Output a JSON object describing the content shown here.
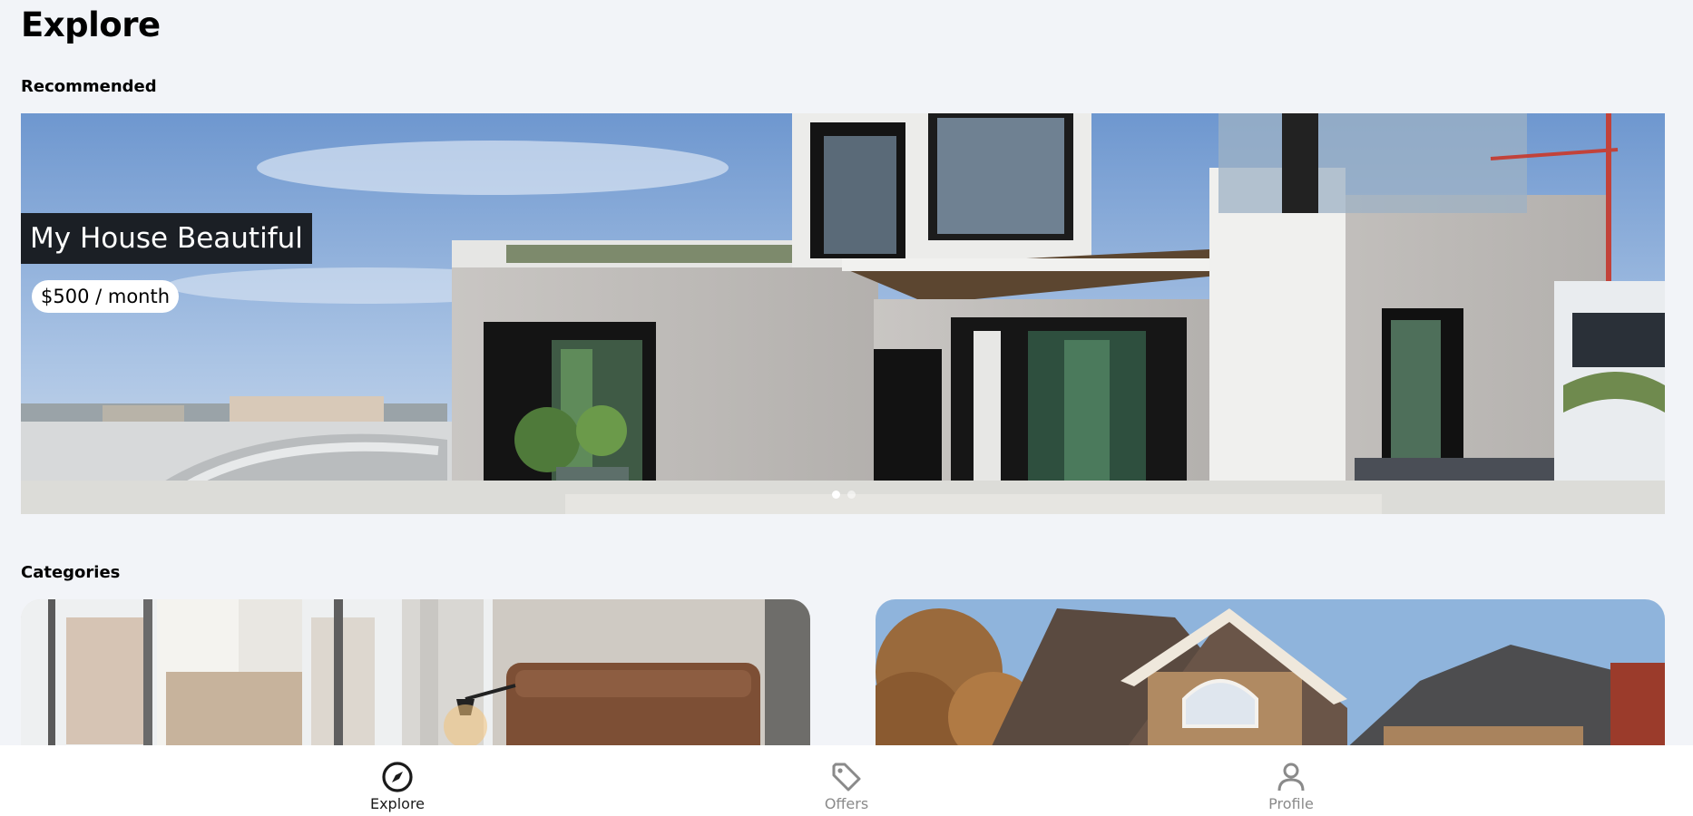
{
  "header": {
    "title": "Explore"
  },
  "recommended": {
    "heading": "Recommended",
    "slides_total": 2,
    "active_slide": 1,
    "hero": {
      "title": "My House Beautiful",
      "price": "$500 / month"
    }
  },
  "categories": {
    "heading": "Categories",
    "cards": [
      {
        "image": "bedroom-interior-photo"
      },
      {
        "image": "suburban-house-photo"
      }
    ]
  },
  "nav": {
    "items": [
      {
        "label": "Explore",
        "icon": "compass-icon",
        "active": true
      },
      {
        "label": "Offers",
        "icon": "tag-icon",
        "active": false
      },
      {
        "label": "Profile",
        "icon": "user-icon",
        "active": false
      }
    ]
  },
  "colors": {
    "background": "#f2f4f8",
    "title_badge": "#1b1f25",
    "nav_active": "#1a1a1a",
    "nav_inactive": "#8a8a8a"
  }
}
